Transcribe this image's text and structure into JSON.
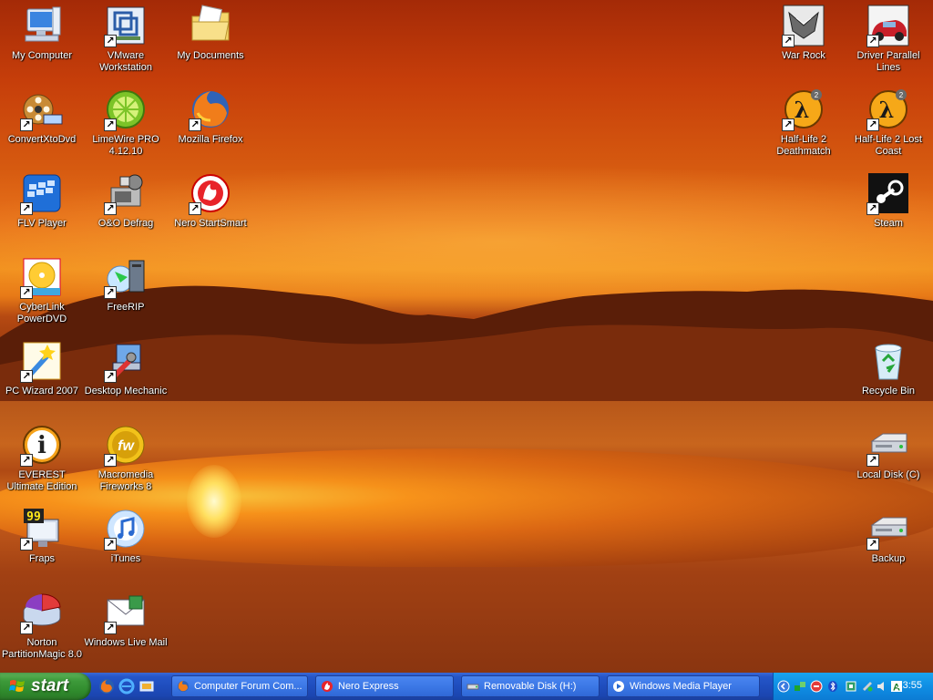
{
  "desktop": {
    "icons_left": [
      {
        "label": "My Computer",
        "icon": "computer-icon",
        "shortcut": false
      },
      {
        "label": "VMware Workstation",
        "icon": "vmware-icon",
        "shortcut": true
      },
      {
        "label": "My Documents",
        "icon": "folder-icon",
        "shortcut": false
      },
      {
        "label": "ConvertXtoDvd",
        "icon": "film-reel-icon",
        "shortcut": true
      },
      {
        "label": "LimeWire PRO 4.12.10",
        "icon": "lime-icon",
        "shortcut": true
      },
      {
        "label": "Mozilla Firefox",
        "icon": "firefox-icon",
        "shortcut": true
      },
      {
        "label": "FLV Player",
        "icon": "flv-player-icon",
        "shortcut": true
      },
      {
        "label": "O&O Defrag",
        "icon": "defrag-icon",
        "shortcut": true
      },
      {
        "label": "Nero StartSmart",
        "icon": "nero-icon",
        "shortcut": true
      },
      {
        "label": "CyberLink PowerDVD",
        "icon": "dvd-icon",
        "shortcut": true
      },
      {
        "label": "FreeRIP",
        "icon": "freerip-icon",
        "shortcut": true
      },
      {
        "label": "PC Wizard 2007",
        "icon": "pc-wizard-icon",
        "shortcut": true
      },
      {
        "label": "Desktop Mechanic",
        "icon": "desktop-mechanic-icon",
        "shortcut": true
      },
      {
        "label": "EVEREST Ultimate Edition",
        "icon": "info-icon",
        "shortcut": true
      },
      {
        "label": "Macromedia Fireworks 8",
        "icon": "fireworks-icon",
        "shortcut": true
      },
      {
        "label": "Fraps",
        "icon": "fraps-icon",
        "shortcut": true
      },
      {
        "label": "iTunes",
        "icon": "itunes-icon",
        "shortcut": true
      },
      {
        "label": "Norton PartitionMagic 8.0",
        "icon": "partition-icon",
        "shortcut": true
      },
      {
        "label": "Windows Live Mail",
        "icon": "mail-icon",
        "shortcut": true
      }
    ],
    "icons_right": [
      {
        "label": "War Rock",
        "icon": "war-rock-icon",
        "shortcut": true
      },
      {
        "label": "Driver Parallel Lines",
        "icon": "car-icon",
        "shortcut": true
      },
      {
        "label": "Half-Life 2 Deathmatch",
        "icon": "half-life-icon",
        "shortcut": true
      },
      {
        "label": "Half-Life 2 Lost Coast",
        "icon": "half-life-icon",
        "shortcut": true
      },
      {
        "label": "Steam",
        "icon": "steam-icon",
        "shortcut": true
      },
      {
        "label": "Recycle Bin",
        "icon": "recycle-bin-icon",
        "shortcut": false
      },
      {
        "label": "Local Disk (C)",
        "icon": "hard-drive-icon",
        "shortcut": true
      },
      {
        "label": "Backup",
        "icon": "hard-drive-icon",
        "shortcut": true
      }
    ]
  },
  "taskbar": {
    "start_label": "start",
    "quick_launch": [
      "firefox-icon",
      "internet-explorer-icon",
      "show-desktop-icon"
    ],
    "tasks": [
      {
        "label": "Computer Forum Com...",
        "icon": "firefox-icon"
      },
      {
        "label": "Nero Express",
        "icon": "nero-icon"
      },
      {
        "label": "Removable Disk (H:)",
        "icon": "removable-disk-icon"
      },
      {
        "label": "Windows Media Player",
        "icon": "media-player-icon"
      }
    ],
    "tray": {
      "icons": [
        "chevron-left-icon",
        "network-icon",
        "antivirus-icon",
        "bluetooth-icon",
        "device-icon",
        "safely-remove-icon",
        "volume-icon",
        "antivirus-a-icon"
      ],
      "clock": "23:55"
    }
  },
  "colors": {
    "taskbar_blue": "#2556c9",
    "start_green": "#3d9a3a",
    "tray_blue": "#0f8ee4",
    "wallpaper_orange": "#e8721a"
  }
}
